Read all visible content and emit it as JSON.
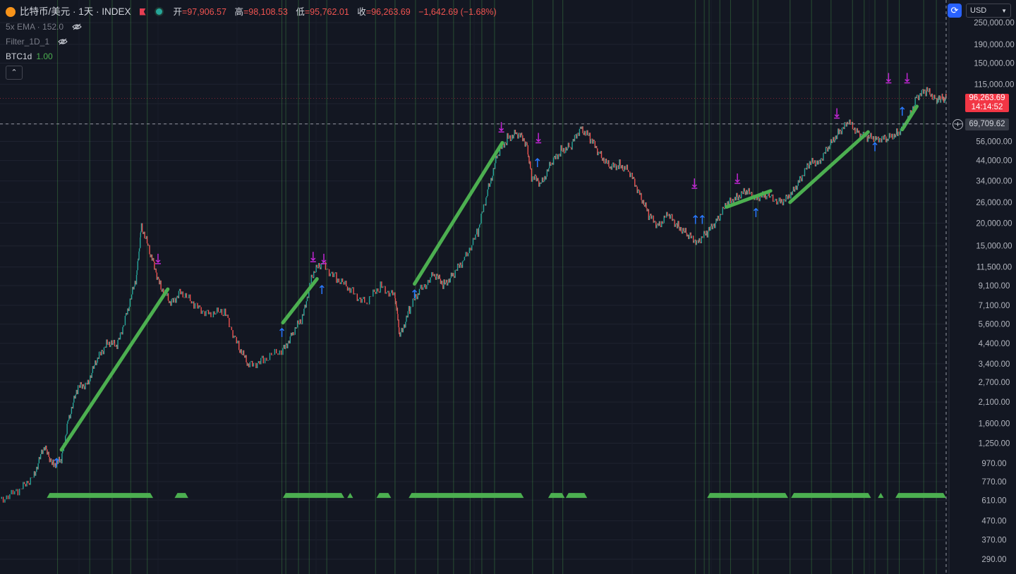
{
  "legend": {
    "symbol": "比特币/美元 · 1天 · INDEX",
    "open_label": "开",
    "open": "=97,906.57",
    "high_label": "高",
    "high": "=98,108.53",
    "low_label": "低",
    "low": "=95,762.01",
    "close_label": "收",
    "close": "=96,263.69",
    "change": "−1,642.69 (−1.68%)",
    "indicators": [
      {
        "name": "5x EMA · 152.0",
        "value": ""
      },
      {
        "name": "Filter_1D_1",
        "value": ""
      },
      {
        "name": "BTC1d",
        "value": "1.00"
      }
    ],
    "collapse_icon": "chevron-up-icon"
  },
  "toolbar": {
    "currency": "USD",
    "sync_icon": "sync-icon"
  },
  "price_tag": {
    "price": "96,263.69",
    "countdown": "14:14:52"
  },
  "crosshair_tag": {
    "price": "69,709.62"
  },
  "colors": {
    "background": "#131722",
    "up": "#26a69a",
    "down": "#ef5350",
    "trend": "#4caf50",
    "sell_signal": "#c026d3",
    "buy_signal": "#2979ff",
    "vline": "#4caf50",
    "price_tag": "#f23645"
  },
  "chart_data": {
    "type": "line",
    "title": "",
    "y_scale": "log",
    "y_ticks": [
      290,
      370,
      470,
      610,
      770,
      970,
      1250,
      1600,
      2100,
      2700,
      3400,
      4400,
      5600,
      7100,
      9100,
      11500,
      15000,
      20000,
      26000,
      34000,
      44000,
      56000,
      69709.62,
      90000,
      115000,
      150000,
      190000,
      250000
    ],
    "y_tick_labels": [
      "290.00",
      "370.00",
      "470.00",
      "610.00",
      "770.00",
      "970.00",
      "1,250.00",
      "1,600.00",
      "2,100.00",
      "2,700.00",
      "3,400.00",
      "4,400.00",
      "5,600.00",
      "7,100.00",
      "9,100.00",
      "11,500.00",
      "15,000.00",
      "20,000.00",
      "26,000.00",
      "34,000.00",
      "44,000.00",
      "56,000.00",
      "",
      "",
      "115,000.00",
      "150,000.00",
      "190,000.00",
      "250,000.00"
    ],
    "last_close": 96263.69,
    "crosshair_price": 69709.62,
    "price_series": [
      [
        0.0,
        620
      ],
      [
        0.02,
        680
      ],
      [
        0.035,
        850
      ],
      [
        0.045,
        1180
      ],
      [
        0.055,
        960
      ],
      [
        0.063,
        1000
      ],
      [
        0.07,
        1700
      ],
      [
        0.08,
        2500
      ],
      [
        0.09,
        2700
      ],
      [
        0.1,
        3600
      ],
      [
        0.11,
        4500
      ],
      [
        0.12,
        4200
      ],
      [
        0.13,
        6500
      ],
      [
        0.14,
        10000
      ],
      [
        0.145,
        19500
      ],
      [
        0.155,
        13000
      ],
      [
        0.165,
        9000
      ],
      [
        0.175,
        7200
      ],
      [
        0.185,
        8500
      ],
      [
        0.2,
        7000
      ],
      [
        0.215,
        6400
      ],
      [
        0.23,
        6500
      ],
      [
        0.245,
        4200
      ],
      [
        0.255,
        3300
      ],
      [
        0.27,
        3600
      ],
      [
        0.29,
        4000
      ],
      [
        0.3,
        5000
      ],
      [
        0.31,
        6000
      ],
      [
        0.32,
        10500
      ],
      [
        0.33,
        12000
      ],
      [
        0.345,
        10000
      ],
      [
        0.36,
        8500
      ],
      [
        0.375,
        7300
      ],
      [
        0.39,
        9000
      ],
      [
        0.405,
        8000
      ],
      [
        0.41,
        4800
      ],
      [
        0.42,
        6800
      ],
      [
        0.43,
        8500
      ],
      [
        0.445,
        10500
      ],
      [
        0.455,
        9200
      ],
      [
        0.465,
        10500
      ],
      [
        0.475,
        12500
      ],
      [
        0.49,
        18000
      ],
      [
        0.5,
        30000
      ],
      [
        0.51,
        47000
      ],
      [
        0.52,
        58000
      ],
      [
        0.53,
        62000
      ],
      [
        0.54,
        55000
      ],
      [
        0.545,
        36000
      ],
      [
        0.555,
        33000
      ],
      [
        0.565,
        42000
      ],
      [
        0.575,
        50000
      ],
      [
        0.585,
        52000
      ],
      [
        0.595,
        67000
      ],
      [
        0.605,
        58000
      ],
      [
        0.615,
        48000
      ],
      [
        0.625,
        40000
      ],
      [
        0.635,
        42000
      ],
      [
        0.645,
        38000
      ],
      [
        0.655,
        30000
      ],
      [
        0.665,
        22000
      ],
      [
        0.675,
        19500
      ],
      [
        0.685,
        22000
      ],
      [
        0.695,
        19500
      ],
      [
        0.705,
        17000
      ],
      [
        0.715,
        16000
      ],
      [
        0.725,
        17500
      ],
      [
        0.735,
        21000
      ],
      [
        0.745,
        25000
      ],
      [
        0.755,
        28000
      ],
      [
        0.765,
        29500
      ],
      [
        0.775,
        28000
      ],
      [
        0.785,
        28000
      ],
      [
        0.8,
        26500
      ],
      [
        0.81,
        27500
      ],
      [
        0.82,
        35000
      ],
      [
        0.83,
        42000
      ],
      [
        0.84,
        44000
      ],
      [
        0.85,
        52000
      ],
      [
        0.86,
        64000
      ],
      [
        0.87,
        70000
      ],
      [
        0.88,
        63000
      ],
      [
        0.89,
        58000
      ],
      [
        0.9,
        59000
      ],
      [
        0.91,
        57000
      ],
      [
        0.92,
        63000
      ],
      [
        0.93,
        70000
      ],
      [
        0.94,
        100000
      ],
      [
        0.95,
        105000
      ],
      [
        0.96,
        96000
      ],
      [
        0.965,
        95000
      ],
      [
        0.97,
        96263.69
      ]
    ],
    "trend_segments": [
      {
        "from": [
          0.063,
          1150
        ],
        "to": [
          0.172,
          8700
        ]
      },
      {
        "from": [
          0.29,
          5700
        ],
        "to": [
          0.325,
          9900
        ]
      },
      {
        "from": [
          0.425,
          9300
        ],
        "to": [
          0.515,
          55000
        ]
      },
      {
        "from": [
          0.745,
          24500
        ],
        "to": [
          0.79,
          30000
        ]
      },
      {
        "from": [
          0.81,
          26000
        ],
        "to": [
          0.89,
          63000
        ]
      },
      {
        "from": [
          0.925,
          65000
        ],
        "to": [
          0.94,
          87000
        ]
      }
    ],
    "bull_bands": [
      [
        0.048,
        0.157
      ],
      [
        0.179,
        0.193
      ],
      [
        0.29,
        0.353
      ],
      [
        0.356,
        0.362
      ],
      [
        0.386,
        0.401
      ],
      [
        0.419,
        0.537
      ],
      [
        0.562,
        0.579
      ],
      [
        0.58,
        0.602
      ],
      [
        0.725,
        0.808
      ],
      [
        0.811,
        0.893
      ],
      [
        0.9,
        0.906
      ],
      [
        0.918,
        0.97
      ]
    ],
    "vertical_markers": [
      0.059,
      0.092,
      0.115,
      0.134,
      0.151,
      0.289,
      0.293,
      0.306,
      0.317,
      0.335,
      0.385,
      0.405,
      0.426,
      0.449,
      0.465,
      0.482,
      0.494,
      0.507,
      0.546,
      0.567,
      0.577,
      0.713,
      0.722,
      0.727,
      0.738,
      0.749,
      0.772,
      0.777,
      0.81,
      0.832,
      0.852,
      0.874,
      0.886,
      0.897,
      0.91,
      0.922,
      0.947,
      0.96
    ],
    "buy_signals": [
      [
        0.058,
        1030
      ],
      [
        0.289,
        5300
      ],
      [
        0.33,
        9100
      ],
      [
        0.425,
        8600
      ],
      [
        0.551,
        45000
      ],
      [
        0.713,
        22000
      ],
      [
        0.72,
        22000
      ],
      [
        0.775,
        24000
      ],
      [
        0.897,
        55000
      ],
      [
        0.925,
        86000
      ]
    ],
    "sell_signals": [
      [
        0.162,
        12000
      ],
      [
        0.321,
        12300
      ],
      [
        0.332,
        12000
      ],
      [
        0.514,
        63000
      ],
      [
        0.552,
        55000
      ],
      [
        0.712,
        31000
      ],
      [
        0.756,
        33000
      ],
      [
        0.858,
        75000
      ],
      [
        0.911,
        117000
      ],
      [
        0.93,
        117000
      ]
    ]
  }
}
